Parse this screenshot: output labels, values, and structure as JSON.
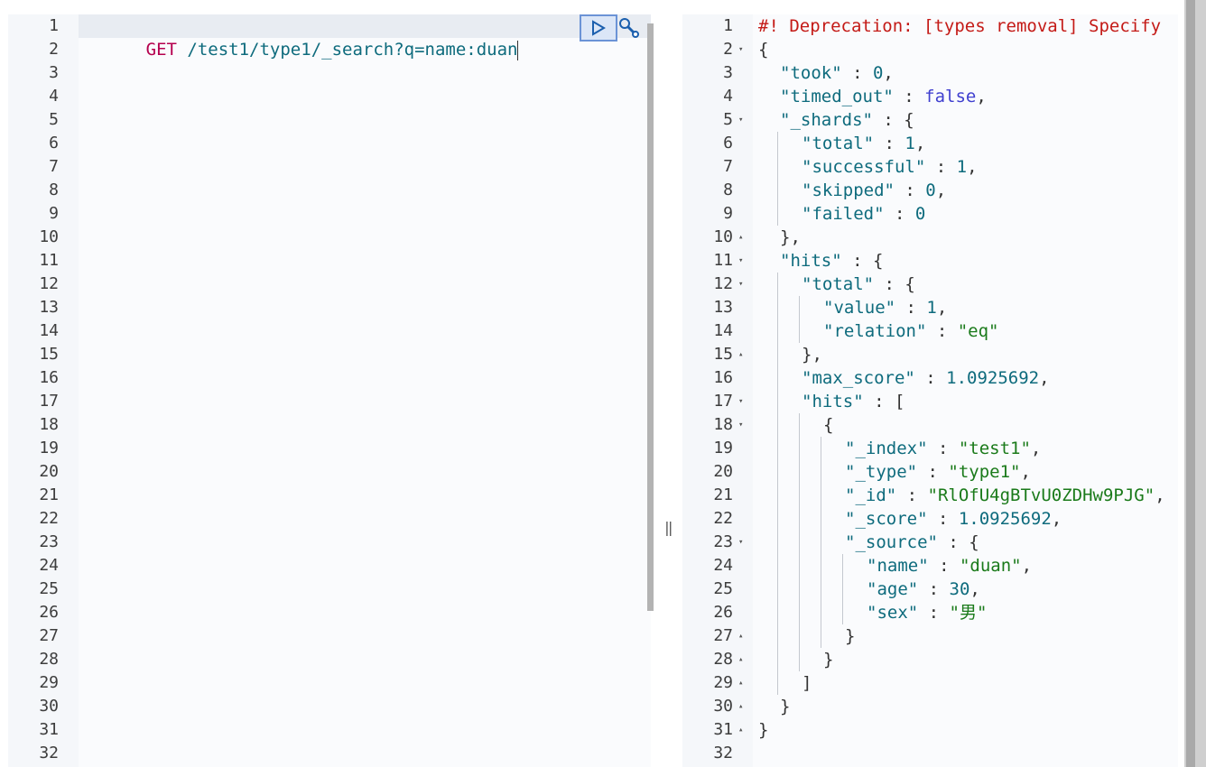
{
  "request": {
    "method": "GET",
    "url": "/test1/type1/_search?q=name:duan",
    "line_count": 32
  },
  "actions": {
    "run_icon": "play-triangle-icon",
    "settings_icon": "wrench-icon"
  },
  "response": {
    "line_count": 32,
    "deprecation": "#! Deprecation: [types removal] Specify",
    "keys": {
      "took": "\"took\"",
      "timed_out": "\"timed_out\"",
      "shards": "\"_shards\"",
      "total": "\"total\"",
      "successful": "\"successful\"",
      "skipped": "\"skipped\"",
      "failed": "\"failed\"",
      "hits": "\"hits\"",
      "value": "\"value\"",
      "relation": "\"relation\"",
      "max_score": "\"max_score\"",
      "index": "\"_index\"",
      "type": "\"_type\"",
      "id": "\"_id\"",
      "score": "\"_score\"",
      "source": "\"_source\"",
      "name": "\"name\"",
      "age": "\"age\"",
      "sex": "\"sex\""
    },
    "values": {
      "took": "0",
      "timed_out": "false",
      "shards_total": "1",
      "shards_successful": "1",
      "shards_skipped": "0",
      "shards_failed": "0",
      "hits_total_value": "1",
      "hits_total_relation": "\"eq\"",
      "max_score": "1.0925692",
      "index": "\"test1\"",
      "type": "\"type1\"",
      "id": "\"RlOfU4gBTvU0ZDHw9PJG\"",
      "score": "1.0925692",
      "name": "\"duan\"",
      "age": "30",
      "sex": "\"男\""
    }
  },
  "colors": {
    "key": "#0e6b7d",
    "string": "#1a7a1a",
    "boolean": "#3f3fcf",
    "method": "#b5004e",
    "comment": "#c41a16"
  }
}
